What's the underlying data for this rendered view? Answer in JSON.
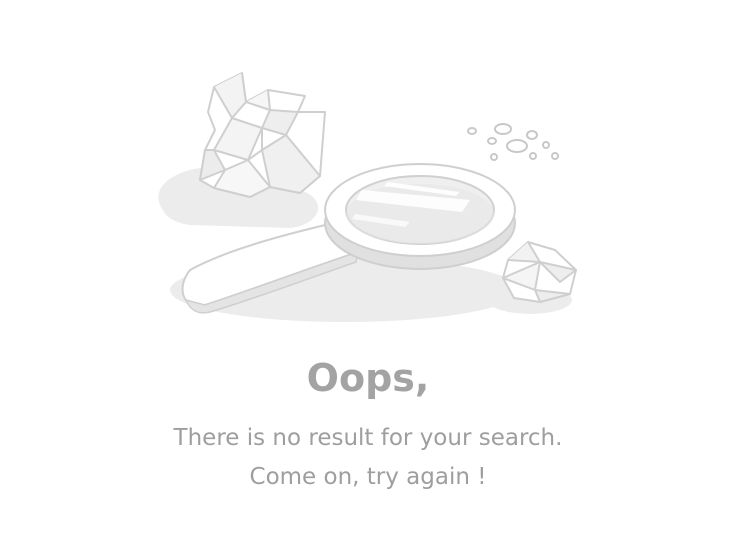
{
  "empty_state": {
    "title": "Oops,",
    "message_line_1": "There is no result for your search.",
    "message_line_2": "Come on, try again !",
    "illustration_icons": [
      "crumpled-paper-icon",
      "magnifying-glass-icon",
      "crumbs-icon"
    ],
    "colors": {
      "text": "#9e9e9e",
      "title": "#a3a3a3",
      "outline": "#d2d2d2",
      "shadow": "#ececec"
    }
  }
}
